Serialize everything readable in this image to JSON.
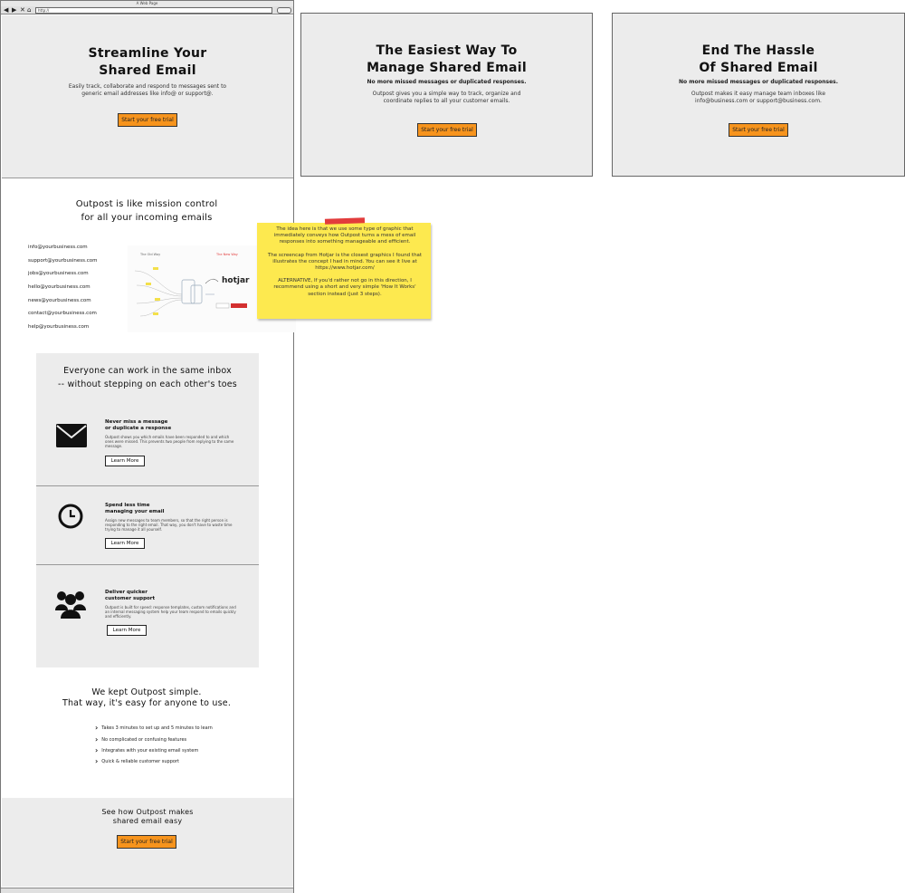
{
  "browser": {
    "window_title": "A Web Page",
    "url": "http://",
    "nav_icons": [
      "back-arrow-icon",
      "forward-arrow-icon",
      "close-x-icon",
      "home-icon"
    ]
  },
  "hero": {
    "title_line1": "Streamline Your",
    "title_line2": "Shared Email",
    "desc_line1": "Easily track, collaborate and respond to messages sent to",
    "desc_line2": "generic email addresses like info@ or support@.",
    "cta": "Start your free trial"
  },
  "alt_hero_1": {
    "title_line1": "The Easiest Way To",
    "title_line2": "Manage Shared Email",
    "subtitle": "No more missed messages or duplicated responses.",
    "desc_line1": "Outpost gives you a simple way to track, organize and",
    "desc_line2": "coordinate replies to all your customer emails.",
    "cta": "Start your free trial"
  },
  "alt_hero_2": {
    "title_line1": "End The Hassle",
    "title_line2": "Of Shared Email",
    "subtitle": "No more missed messages or duplicated responses.",
    "desc_line1": "Outpost makes it easy manage team inboxes like",
    "desc_line2": "info@business.com or support@business.com.",
    "cta": "Start your free trial"
  },
  "mission": {
    "title_line1": "Outpost is like mission control",
    "title_line2": "for all your incoming emails",
    "emails": [
      "info@yourbusiness.com",
      "support@yourbusiness.com",
      "jobs@yourbusiness.com",
      "hello@yourbusiness.com",
      "news@yourbusiness.com",
      "contact@yourbusiness.com",
      "help@yourbusiness.com"
    ],
    "graphic": {
      "old_way": "The Old Way",
      "new_way": "The New Way",
      "logo": "hotjar"
    }
  },
  "sticky_note": {
    "p1": "The idea here is that we use some type of graphic that immediately conveys how Outpost turns a mess of email responses into something manageable and efficient.",
    "p2": "The screencap from Hotjar is the closest graphics I found that illustrates the concept I had in mind. You can see it live at https://www.hotjar.com/",
    "p3": "ALTERNATIVE, If you'd rather not go in this direction, I recommend using a short and very simple 'How It Works' section instead (just 3 steps)."
  },
  "features": {
    "title_line1": "Everyone can work in the same inbox",
    "title_line2": "-- without stepping on each other's toes",
    "items": [
      {
        "icon": "envelope-icon",
        "title_line1": "Never miss a message",
        "title_line2": "or duplicate a response",
        "body": "Outpost shows you which emails have been responded to and which ones were missed. This prevents two people from replying to the same message.",
        "button": "Learn More"
      },
      {
        "icon": "clock-icon",
        "title_line1": "Spend less time",
        "title_line2": "managing your email",
        "body": "Assign new messages to team members, so that the right person is responding to the right email. That way, you don't have to waste time trying to manage it all yourself.",
        "button": "Learn More"
      },
      {
        "icon": "team-icon",
        "title_line1": "Deliver quicker",
        "title_line2": "customer support",
        "body": "Outpost is built for speed: response templates, custom notifications and an internal messaging system help your team respond to emails quickly and efficiently.",
        "button": "Learn More"
      }
    ]
  },
  "simple": {
    "title_line1": "We kept Outpost simple.",
    "title_line2": "That way, it's easy for anyone to use.",
    "items": [
      "Takes 3 minutes to set up and 5 minutes to learn",
      "No complicated or confusing features",
      "Integrates with your existing email system",
      "Quick & reliable customer support"
    ]
  },
  "footer_cta": {
    "title_line1": "See how Outpost makes",
    "title_line2": "shared email easy",
    "cta": "Start your free trial"
  }
}
